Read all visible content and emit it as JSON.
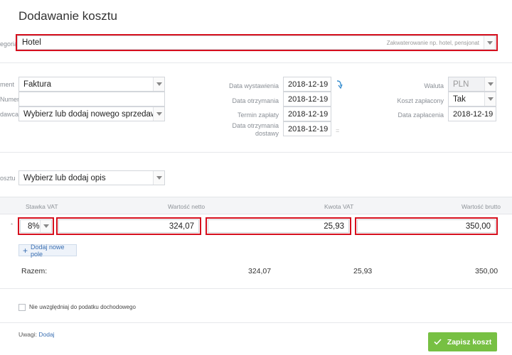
{
  "page": {
    "title": "Dodawanie kosztu"
  },
  "category": {
    "label": "egoria",
    "value": "Hotel",
    "hint": "Zakwaterowanie np. hotel, pensjonat"
  },
  "document": {
    "type_label": "ment",
    "type_value": "Faktura",
    "number_label": "Numer",
    "number_value": "",
    "seller_label": "dawca",
    "seller_value": "Wybierz lub dodaj nowego sprzedawcę"
  },
  "dates": {
    "issue_label": "Data wystawienia",
    "issue_value": "2018-12-19",
    "received_label": "Data otrzymania",
    "received_value": "2018-12-19",
    "due_label": "Termin zapłaty",
    "due_value": "2018-12-19",
    "delivery_label_1": "Data otrzymania",
    "delivery_label_2": "dostawy",
    "delivery_value": "2018-12-19"
  },
  "payment": {
    "currency_label": "Waluta",
    "currency_value": "PLN",
    "paid_label": "Koszt zapłacony",
    "paid_value": "Tak",
    "paid_date_label": "Data zapłacenia",
    "paid_date_value": "2018-12-19"
  },
  "description": {
    "label": "osztu",
    "value": "Wybierz lub dodaj opis"
  },
  "table": {
    "headers": {
      "vat_rate": "Stawka VAT",
      "net": "Wartość netto",
      "vat_amount": "Kwota VAT",
      "gross": "Wartość brutto"
    },
    "row": {
      "vat_rate": "8%",
      "net": "324,07",
      "vat_amount": "25,93",
      "gross": "350,00"
    },
    "add_label": "Dodaj nowe pole",
    "total_label": "Razem:",
    "totals": {
      "net": "324,07",
      "vat_amount": "25,93",
      "gross": "350,00"
    }
  },
  "options": {
    "exclude_income_tax_label": "Nie uwzględniaj do podatku dochodowego"
  },
  "notes": {
    "label": "Uwagi:",
    "link": "Dodaj"
  },
  "actions": {
    "save_label": "Zapisz koszt"
  },
  "colors": {
    "highlight": "#d6101e",
    "save": "#77c043",
    "link": "#3a6fb2"
  }
}
